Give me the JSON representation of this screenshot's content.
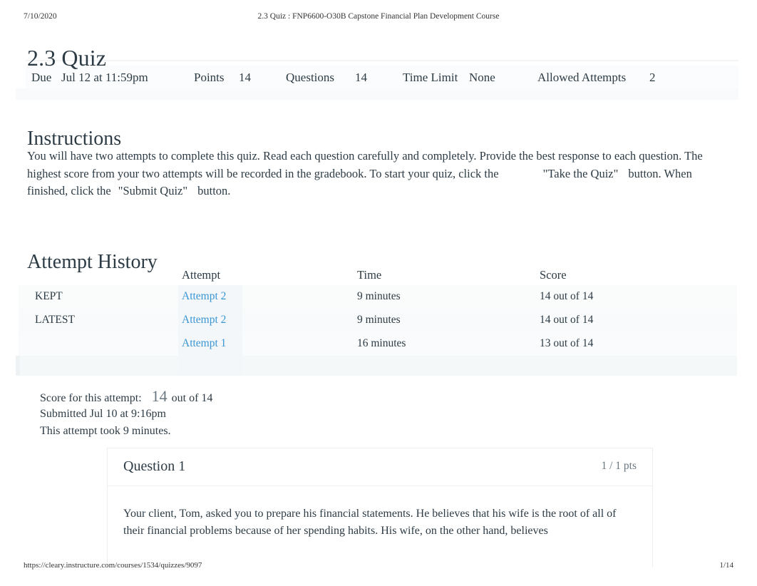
{
  "print": {
    "date": "7/10/2020",
    "header_title": "2.3 Quiz : FNP6600-O30B Capstone Financial Plan Development Course",
    "footer_url": "https://cleary.instructure.com/courses/1534/quizzes/9097",
    "footer_page": "1/14"
  },
  "page": {
    "title": "2.3 Quiz"
  },
  "details": {
    "due_label": "Due",
    "due_value": "Jul 12 at 11:59pm",
    "points_label": "Points",
    "points_value": "14",
    "questions_label": "Questions",
    "questions_value": "14",
    "time_limit_label": "Time Limit",
    "time_limit_value": "None",
    "allowed_attempts_label": "Allowed Attempts",
    "allowed_attempts_value": "2"
  },
  "instructions": {
    "heading": "Instructions",
    "part1": "You will have two attempts to complete this quiz. Read each question carefully and completely. Provide the best response to each question. The highest score from your two attempts will be recorded in the gradebook. To start your quiz, click the",
    "take_quiz": "\"Take the Quiz\"",
    "part2": "button. When finished, click the",
    "submit_quiz": "\"Submit Quiz\"",
    "part3": "button."
  },
  "attempt_history": {
    "heading": "Attempt History",
    "columns": {
      "label": "",
      "attempt": "Attempt",
      "time": "Time",
      "score": "Score"
    },
    "rows": [
      {
        "label": "KEPT",
        "attempt": "Attempt 2",
        "time": "9 minutes",
        "score": "14 out of 14"
      },
      {
        "label": "LATEST",
        "attempt": "Attempt 2",
        "time": "9 minutes",
        "score": "14 out of 14"
      },
      {
        "label": "",
        "attempt": "Attempt 1",
        "time": "16 minutes",
        "score": "13 out of 14"
      }
    ]
  },
  "score_summary": {
    "score_prefix": "Score for this attempt:",
    "score_value": "14",
    "score_suffix": "out of 14",
    "submitted": "Submitted Jul 10 at 9:16pm",
    "duration": "This attempt took 9 minutes."
  },
  "question": {
    "title": "Question 1",
    "points": "1 / 1 pts",
    "body": "Your client, Tom, asked you to prepare his financial statements. He believes that his wife is the root of all of their financial problems because of her spending habits. His wife, on the other hand, believes"
  },
  "colors": {
    "link": "#3a95d3",
    "text": "#2d3b45",
    "muted": "#6b7780",
    "band": "#f7f9fa"
  }
}
